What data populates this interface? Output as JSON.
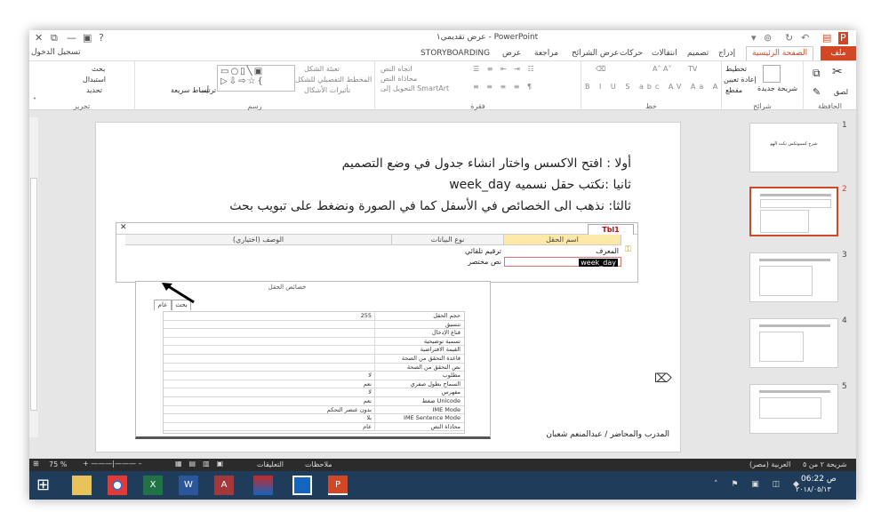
{
  "window": {
    "title": "عرض تقديمي١ - PowerPoint",
    "sign_in": "تسجيل الدخول"
  },
  "tabs": [
    {
      "label": "ملف"
    },
    {
      "label": "الصفحة الرئيسية"
    },
    {
      "label": "إدراج"
    },
    {
      "label": "تصميم"
    },
    {
      "label": "انتقالات"
    },
    {
      "label": "حركات"
    },
    {
      "label": "عرض الشرائح"
    },
    {
      "label": "مراجعة"
    },
    {
      "label": "عرض"
    },
    {
      "label": "STORYBOARDING"
    }
  ],
  "ribbon": {
    "groups": {
      "clipboard": "الحافظة",
      "slides": "شرائح",
      "font": "خط",
      "paragraph": "فقرة",
      "drawing": "رسم",
      "editing": "تحرير"
    },
    "clipboard": {
      "paste": "لصق"
    },
    "slides": {
      "new_slide": "شريحة جديدة",
      "layout": "تخطيط",
      "reset": "إعادة تعيين",
      "section": "مقطع"
    },
    "font": {
      "size": "TV"
    },
    "paragraph": {
      "text_direction": "اتجاه النص",
      "align_text": "محاذاة النص",
      "smartart": "التحويل إلى SmartArt"
    },
    "drawing": {
      "arrange": "ترتيب",
      "quick_styles": "أنماط سريعة",
      "shape_fill": "تعبئة الشكل",
      "shape_outline": "المخطط التفصيلي للشكل",
      "shape_effects": "تأثيرات الأشكال"
    },
    "editing": {
      "find": "بحث",
      "replace": "استبدال",
      "select": "تحديد"
    }
  },
  "slide": {
    "line1": "أولا : افتح الاكسس واختار انشاء جدول في وضع التصميم",
    "line2": "ثانيا :نكتب حقل نسميه week_day",
    "line3": "ثالثا: نذهب الى الخصائص في الأسفل كما في الصورة ونضغط على تبويب بحث",
    "trainer": "المدرب والمحاضر / عبدالمنعم شعبان"
  },
  "access": {
    "table_tab": "Tbl1",
    "columns": {
      "field_name": "اسم الحقل",
      "data_type": "نوع البيانات",
      "description": "الوصف (اختياري)"
    },
    "rows": [
      {
        "name": "المعرف",
        "type": "ترقيم تلقائي"
      },
      {
        "name": "week_day",
        "type": "نص مختصر"
      }
    ],
    "props_title": "خصائص الحقل",
    "prop_tabs": {
      "general": "عام",
      "lookup": "بحث"
    },
    "properties": [
      {
        "label": "حجم الحقل",
        "value": "255"
      },
      {
        "label": "تنسيق",
        "value": ""
      },
      {
        "label": "قناع الإدخال",
        "value": ""
      },
      {
        "label": "تسمية توضيحية",
        "value": ""
      },
      {
        "label": "القيمة الافتراضية",
        "value": ""
      },
      {
        "label": "قاعدة التحقق من الصحة",
        "value": ""
      },
      {
        "label": "نص التحقق من الصحة",
        "value": ""
      },
      {
        "label": "مطلوب",
        "value": "لا"
      },
      {
        "label": "السماح بطول صفري",
        "value": "نعم"
      },
      {
        "label": "مفهرس",
        "value": "لا"
      },
      {
        "label": "ضغط Unicode",
        "value": "نعم"
      },
      {
        "label": "IME Mode",
        "value": "بدون عنصر التحكم"
      },
      {
        "label": "IME Sentence Mode",
        "value": "بلا"
      },
      {
        "label": "محاذاة النص",
        "value": "عام"
      }
    ]
  },
  "thumbnails": [
    {
      "num": "1",
      "text": "شرح كمبيوتكس نكت الهو"
    },
    {
      "num": "2",
      "text": ""
    },
    {
      "num": "3",
      "text": ""
    },
    {
      "num": "4",
      "text": ""
    },
    {
      "num": "5",
      "text": ""
    }
  ],
  "status": {
    "slide_info": "شريحة ٢ من ٥",
    "language": "العربية (مصر)",
    "notes": "ملاحظات",
    "comments": "التعليقات",
    "zoom": "75 %"
  },
  "taskbar": {
    "time": "06:22 ص",
    "date": "٢٠١٨/٠٥/١٣"
  },
  "colors": {
    "accent": "#d24726",
    "taskbar": "#1f3d5a"
  }
}
